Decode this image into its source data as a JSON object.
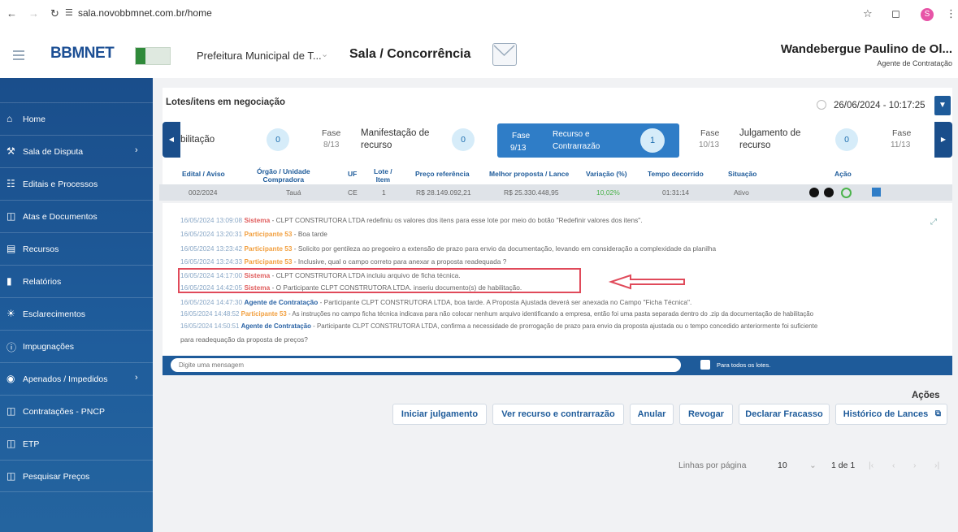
{
  "browser": {
    "url": "sala.novobbmnet.com.br/home",
    "profile_initial": "S"
  },
  "header": {
    "logo": "BBMNET",
    "organization": "Prefeitura Municipal de T...",
    "room_title": "Sala / Concorrência",
    "user_name": "Wandebergue Paulino de Ol...",
    "user_role": "Agente de Contratação"
  },
  "sidebar": {
    "items": [
      {
        "label": "Home",
        "icon": "home-icon"
      },
      {
        "label": "Sala de Disputa",
        "icon": "gavel-icon",
        "chevron": true
      },
      {
        "label": "Editais e Processos",
        "icon": "cart-icon"
      },
      {
        "label": "Atas e Documentos",
        "icon": "file-icon"
      },
      {
        "label": "Recursos",
        "icon": "document-icon"
      },
      {
        "label": "Relatórios",
        "icon": "bar-chart-icon"
      },
      {
        "label": "Esclarecimentos",
        "icon": "lightbulb-icon"
      },
      {
        "label": "Impugnações",
        "icon": "info-icon"
      },
      {
        "label": "Apenados / Impedidos",
        "icon": "at-icon",
        "chevron": true
      },
      {
        "label": "Contratações - PNCP",
        "icon": "file-icon"
      },
      {
        "label": "ETP",
        "icon": "file-icon"
      },
      {
        "label": "Pesquisar Preços",
        "icon": "file-icon"
      }
    ]
  },
  "lots": {
    "title": "Lotes/itens em negociação",
    "datetime": "26/06/2024 - 10:17:25"
  },
  "phases": [
    {
      "label": "bilitação",
      "count": "0"
    },
    {
      "fase": "Fase",
      "num": "8/13",
      "label_1": "Manifestação de",
      "label_2": "recurso",
      "count": "0"
    },
    {
      "fase": "Fase",
      "num": "9/13",
      "label_1": "Recurso e",
      "label_2": "Contrarrazão",
      "count": "1",
      "active": true
    },
    {
      "fase": "Fase",
      "num": "10/13",
      "label_1": "Julgamento de",
      "label_2": "recurso",
      "count": "0"
    },
    {
      "fase": "Fase",
      "num": "11/13"
    }
  ],
  "table": {
    "headers": {
      "edital": "Edital / Aviso",
      "orgao_1": "Órgão / Unidade",
      "orgao_2": "Compradora",
      "uf": "UF",
      "lote_1": "Lote /",
      "lote_2": "Item",
      "preco": "Preço referência",
      "melhor": "Melhor proposta / Lance",
      "variacao": "Variação (%)",
      "tempo": "Tempo decorrido",
      "situacao": "Situação",
      "acao": "Ação"
    },
    "row": {
      "edital": "002/2024",
      "orgao": "Tauá",
      "uf": "CE",
      "lote": "1",
      "preco": "R$ 28.149.092,21",
      "melhor": "R$ 25.330.448,95",
      "variacao": "10,02%",
      "tempo": "01:31:14",
      "situacao": "Ativo"
    }
  },
  "chat": {
    "messages": [
      {
        "time": "16/05/2024 13:09:08",
        "sender": "Sistema",
        "text": " - CLPT CONSTRUTORA LTDA redefiniu os valores dos itens para esse lote por meio do botão \"Redefinir valores dos itens\"."
      },
      {
        "time": "16/05/2024 13:20:31",
        "sender": "Participante 53",
        "text": " - Boa tarde"
      },
      {
        "time": "16/05/2024 13:23:42",
        "sender": "Participante 53",
        "text": " - Solicito por gentileza ao pregoeiro a extensão de prazo para envio da documentação, levando em consideração a complexidade da planilha"
      },
      {
        "time": "16/05/2024 13:24:33",
        "sender": "Participante 53",
        "text": " - Inclusive, qual o campo correto para anexar a proposta readequada ?"
      },
      {
        "time": "16/05/2024 14:17:00",
        "sender": "Sistema",
        "text": " - CLPT CONSTRUTORA LTDA incluiu arquivo de ficha técnica."
      },
      {
        "time": "16/05/2024 14:42:05",
        "sender": "Sistema",
        "text": " - O Participante CLPT CONSTRUTORA LTDA. inseriu documento(s) de habilitação."
      },
      {
        "time": "16/05/2024 14:47:30",
        "sender": "Agente de Contratação",
        "text": " - Participante CLPT CONSTRUTORA LTDA, boa tarde. A Proposta Ajustada deverá ser anexada no Campo \"Ficha Técnica\"."
      },
      {
        "time": "16/05/2024 14:48:52",
        "sender": "Participante 53",
        "text": " - As instruções no campo ficha técnica indicava para não colocar nenhum arquivo identificando a empresa, então foi uma pasta separada dentro do .zip da documentação de habilitação"
      },
      {
        "time": "16/05/2024 14:50:51",
        "sender": "Agente de Contratação",
        "text": " - Participante CLPT CONSTRUTORA LTDA, confirma a necessidade de prorrogação de prazo para envio da proposta ajustada ou o tempo concedido anteriormente foi suficiente"
      },
      {
        "continuation": "para readequação da proposta de preços?"
      }
    ],
    "input_placeholder": "Digite uma mensagem",
    "checkbox_label": "Para todos os lotes."
  },
  "actions": {
    "title": "Ações",
    "buttons": [
      "Iniciar julgamento",
      "Ver recurso e contrarrazão",
      "Anular",
      "Revogar",
      "Declarar Fracasso",
      "Histórico de Lances"
    ]
  },
  "pagination": {
    "rows_label": "Linhas por página",
    "rows_value": "10",
    "range": "1 de 1"
  },
  "colors": {
    "primary": "#1e5b9a",
    "sidebar": "#1a4e8b",
    "system": "#e05d5d",
    "participant": "#f2a040",
    "agent": "#2a63a5",
    "highlight": "#e04a5a"
  }
}
